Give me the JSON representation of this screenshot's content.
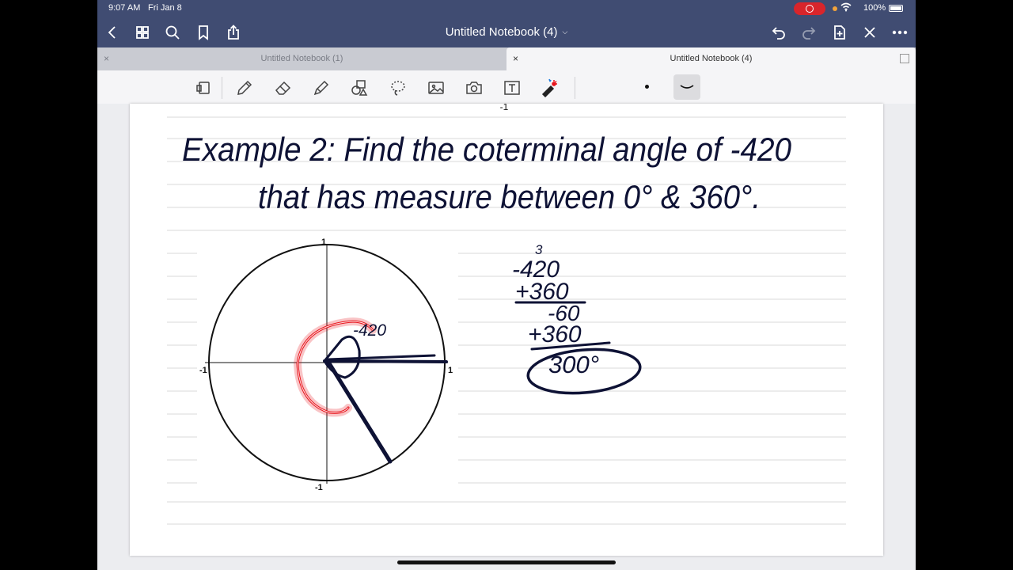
{
  "status": {
    "time": "9:07 AM",
    "date": "Fri Jan 8",
    "battery": "100%"
  },
  "nav": {
    "title": "Untitled Notebook (4)"
  },
  "tabs": [
    {
      "label": "Untitled Notebook (1)",
      "close": "×"
    },
    {
      "label": "Untitled Notebook (4)",
      "close": "×"
    }
  ],
  "page": {
    "top_label": "-1",
    "line1": "Example 2: Find the coterminal angle of -420",
    "line2": "that has measure between 0° & 360°.",
    "axis_labels": {
      "top": "1",
      "bottom": "-1",
      "left": "-1",
      "right": "1"
    },
    "angle_label": "-420",
    "work": {
      "carry": "3",
      "row1": "-420",
      "row2": "+360",
      "row3": "-60",
      "row4": "+360",
      "answer": "300°"
    }
  },
  "colors": {
    "chrome": "#404c72",
    "ink": "#0e1235",
    "highlight": "#e8141c"
  }
}
